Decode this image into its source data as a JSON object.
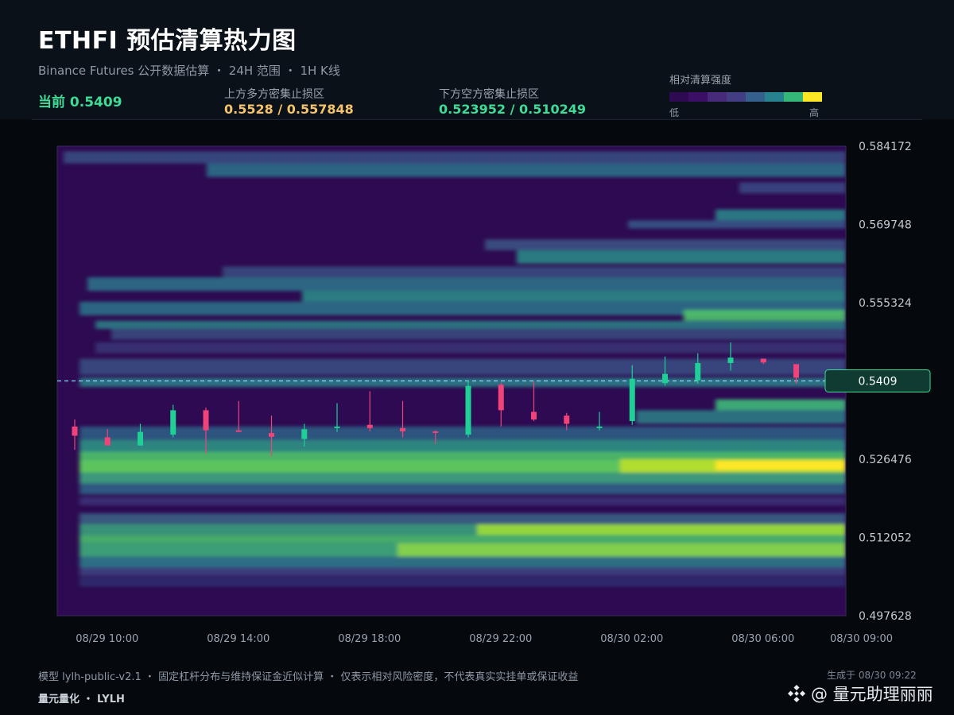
{
  "header": {
    "title": "ETHFI 预估清算热力图",
    "subtitle": "Binance Futures 公开数据估算 ・ 24H 范围 ・ 1H K线",
    "current": "当前 0.5409",
    "upper_label": "上方多方密集止损区",
    "upper_value": "0.5528 / 0.557848",
    "lower_label": "下方空方密集止损区",
    "lower_value": "0.523952 / 0.510249",
    "legend_title": "相对清算强度",
    "legend_low": "低",
    "legend_high": "高",
    "legend_colors": [
      "#2e0a52",
      "#3c0f66",
      "#472a7a",
      "#433d84",
      "#355f8d",
      "#26828e",
      "#35b779",
      "#fde725"
    ]
  },
  "colors": {
    "up": "#1fcf95",
    "down": "#f0437a",
    "current_line": "#8fd6ff",
    "upper_accent": "#f5c46a",
    "lower_accent": "#3ddc97"
  },
  "chart_data": {
    "type": "heatmap",
    "title": "ETHFI 预估清算热力图",
    "ylim": [
      0.497628,
      0.584172
    ],
    "yticks": [
      "0.584172",
      "0.569748",
      "0.555324",
      "0.526476",
      "0.512052",
      "0.497628"
    ],
    "xticks": [
      "08/29 10:00",
      "08/29 14:00",
      "08/29 18:00",
      "08/29 22:00",
      "08/30 02:00",
      "08/30 06:00",
      "08/30 09:00"
    ],
    "x_start": "08/29 09:00",
    "x_end": "08/30 09:00",
    "current_price": 0.5409,
    "current_price_label": "0.5409",
    "candles": [
      {
        "time": "08/29 09:00",
        "open": 0.5325,
        "high": 0.5338,
        "low": 0.5282,
        "close": 0.5308
      },
      {
        "time": "08/29 10:00",
        "open": 0.5305,
        "high": 0.532,
        "low": 0.5292,
        "close": 0.529
      },
      {
        "time": "08/29 11:00",
        "open": 0.529,
        "high": 0.533,
        "low": 0.529,
        "close": 0.5315
      },
      {
        "time": "08/29 12:00",
        "open": 0.531,
        "high": 0.5365,
        "low": 0.5305,
        "close": 0.5355
      },
      {
        "time": "08/29 13:00",
        "open": 0.5355,
        "high": 0.536,
        "low": 0.5275,
        "close": 0.5318
      },
      {
        "time": "08/29 14:00",
        "open": 0.5318,
        "high": 0.5372,
        "low": 0.5315,
        "close": 0.5316
      },
      {
        "time": "08/29 15:00",
        "open": 0.5313,
        "high": 0.5345,
        "low": 0.527,
        "close": 0.5306
      },
      {
        "time": "08/29 16:00",
        "open": 0.5302,
        "high": 0.533,
        "low": 0.5288,
        "close": 0.532
      },
      {
        "time": "08/29 17:00",
        "open": 0.5323,
        "high": 0.5368,
        "low": 0.5315,
        "close": 0.5325
      },
      {
        "time": "08/29 18:00",
        "open": 0.5328,
        "high": 0.539,
        "low": 0.5316,
        "close": 0.5322
      },
      {
        "time": "08/29 19:00",
        "open": 0.5322,
        "high": 0.5372,
        "low": 0.5305,
        "close": 0.5316
      },
      {
        "time": "08/29 20:00",
        "open": 0.5316,
        "high": 0.5318,
        "low": 0.5293,
        "close": 0.5314
      },
      {
        "time": "08/29 21:00",
        "open": 0.531,
        "high": 0.541,
        "low": 0.5305,
        "close": 0.54
      },
      {
        "time": "08/29 22:00",
        "open": 0.5402,
        "high": 0.5406,
        "low": 0.5325,
        "close": 0.5355
      },
      {
        "time": "08/29 23:00",
        "open": 0.5352,
        "high": 0.5408,
        "low": 0.5335,
        "close": 0.5338
      },
      {
        "time": "08/30 00:00",
        "open": 0.5345,
        "high": 0.535,
        "low": 0.5318,
        "close": 0.533
      },
      {
        "time": "08/30 01:00",
        "open": 0.5323,
        "high": 0.5352,
        "low": 0.5318,
        "close": 0.5325
      },
      {
        "time": "08/30 02:00",
        "open": 0.5335,
        "high": 0.5438,
        "low": 0.5328,
        "close": 0.5413
      },
      {
        "time": "08/30 03:00",
        "open": 0.5405,
        "high": 0.5454,
        "low": 0.54,
        "close": 0.5422
      },
      {
        "time": "08/30 04:00",
        "open": 0.541,
        "high": 0.546,
        "low": 0.5404,
        "close": 0.5442
      },
      {
        "time": "08/30 05:00",
        "open": 0.5442,
        "high": 0.548,
        "low": 0.5428,
        "close": 0.5452
      },
      {
        "time": "08/30 06:00",
        "open": 0.545,
        "high": 0.545,
        "low": 0.544,
        "close": 0.5443
      },
      {
        "time": "08/30 07:00",
        "open": 0.544,
        "high": 0.544,
        "low": 0.5404,
        "close": 0.5415
      }
    ]
  },
  "footer": {
    "note": "模型 lylh-public-v2.1 ・ 固定杠杆分布与维持保证金近似计算 ・ 仅表示相对风险密度，不代表真实实挂单或保证收益",
    "brand": "量元量化 ・ LYLH",
    "generated": "生成于 08/30 09:22",
    "watermark": "@ 量元助理丽丽"
  }
}
